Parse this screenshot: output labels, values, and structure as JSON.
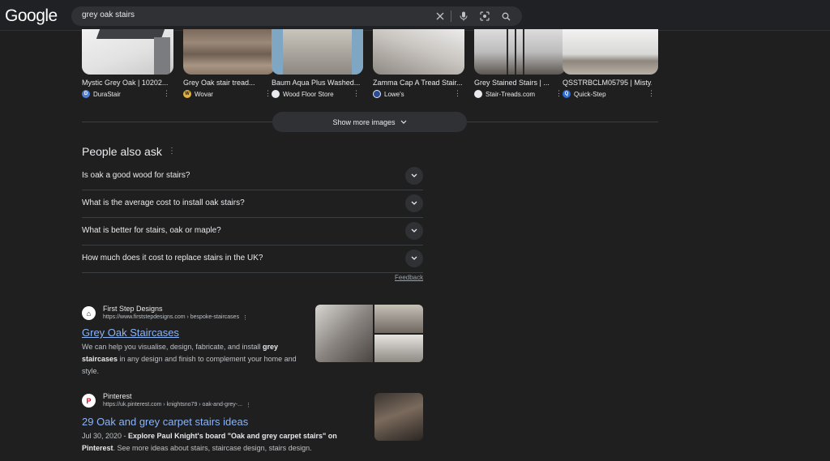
{
  "header": {
    "logo": "Google",
    "query": "grey oak stairs",
    "icons": [
      "clear-icon",
      "mic-icon",
      "lens-icon",
      "search-icon"
    ]
  },
  "images": [
    {
      "title": "Mystic Grey Oak | 10202...",
      "source": "DuraStair",
      "icon_color": "#4f7fd4"
    },
    {
      "title": "Grey Oak stair tread...",
      "source": "Wovar",
      "icon_color": "#e3b23c"
    },
    {
      "title": "Baum Aqua Plus Washed...",
      "source": "Wood Floor Store",
      "icon_color": "#e8eaed"
    },
    {
      "title": "Zamma Cap A Tread Stair...",
      "source": "Lowe's",
      "icon_color": "#2a4a9a"
    },
    {
      "title": "Grey Stained Stairs | ...",
      "source": "Stair-Treads.com",
      "icon_color": "#e8eaed"
    },
    {
      "title": "QSSTRBCLM05795 | Misty...",
      "source": "Quick-Step",
      "icon_color": "#2c6ad4"
    }
  ],
  "show_more": "Show more images",
  "paa": {
    "title": "People also ask",
    "questions": [
      "Is oak a good wood for stairs?",
      "What is the average cost to install oak stairs?",
      "What is better for stairs, oak or maple?",
      "How much does it cost to replace stairs in the UK?"
    ],
    "feedback": "Feedback"
  },
  "results": [
    {
      "site": "First Step Designs",
      "url": "https://www.firststepdesigns.com › bespoke-staircases",
      "title": "Grey Oak Staircases",
      "snippet_1": "We can help you visualise, design, fabricate, and install ",
      "snippet_b1": "grey",
      "snippet_b2": "staircases",
      "snippet_2": " in any design and finish to complement your home and style."
    },
    {
      "site": "Pinterest",
      "url": "https://uk.pinterest.com › knightsno79 › oak-and-grey-...",
      "title": "29 Oak and grey carpet stairs ideas",
      "date": "Jul 30, 2020",
      "snippet_b1": "Explore Paul Knight's board \"Oak and grey carpet stairs\" on Pinterest",
      "snippet_2": ". See more ideas about stairs, staircase design, stairs design."
    }
  ]
}
